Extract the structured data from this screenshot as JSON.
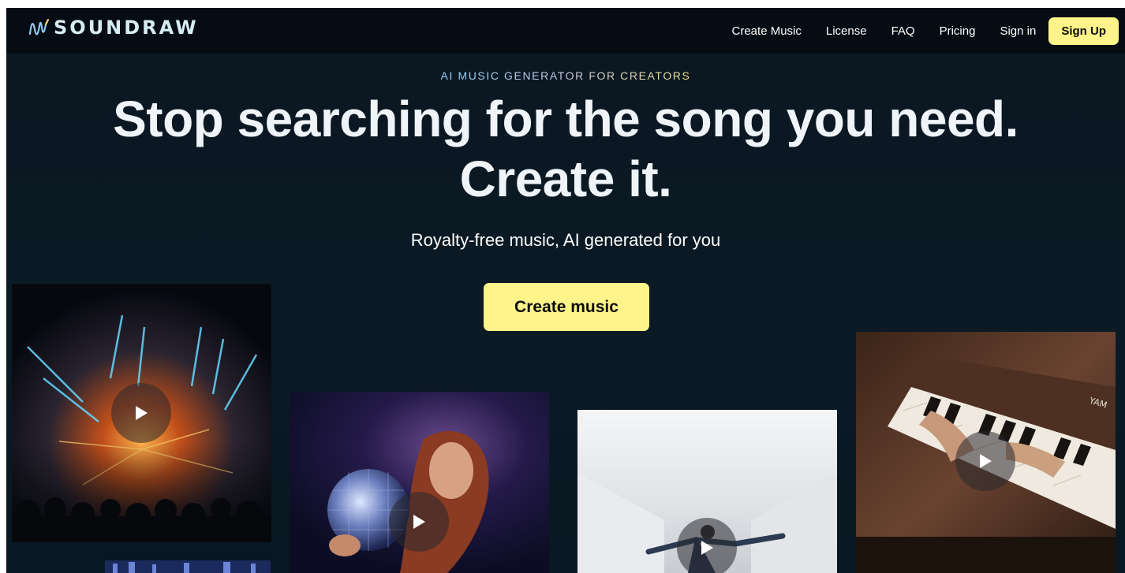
{
  "header": {
    "logo_text": "SOUNDRAW",
    "nav": [
      "Create Music",
      "License",
      "FAQ",
      "Pricing",
      "Sign in"
    ],
    "signup_label": "Sign Up"
  },
  "hero": {
    "eyebrow": "AI MUSIC GENERATOR FOR CREATORS",
    "headline_line1": "Stop searching for the song you need.",
    "headline_line2": "Create it.",
    "subheadline": "Royalty-free music, AI generated for you",
    "cta_label": "Create music"
  },
  "videos": [
    {
      "name": "concert-lights",
      "icon": "play-icon"
    },
    {
      "name": "disco-ball-woman",
      "icon": "play-icon"
    },
    {
      "name": "dancer-white-room",
      "icon": "play-icon"
    },
    {
      "name": "piano-hands",
      "icon": "play-icon",
      "text": "YAM"
    }
  ],
  "colors": {
    "accent": "#fff48a",
    "background": "#0b1620",
    "header": "#050c14"
  }
}
